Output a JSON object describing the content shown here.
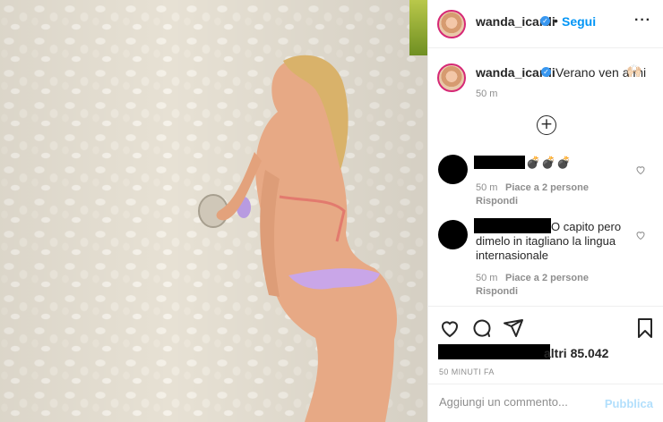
{
  "post": {
    "photo_alt": "post-photo"
  },
  "header": {
    "username": "wanda_icardi",
    "verified_glyph": "✓",
    "separator": "•",
    "follow_label": "Segui",
    "more_glyph": "···"
  },
  "caption": {
    "username": "wanda_icardi",
    "verified_glyph": "✓",
    "text": "Verano ven a mi",
    "emoji": "🙌🏻",
    "time": "50 m"
  },
  "load_more_glyph": "+",
  "comments": [
    {
      "text_visible": "💣💣💣",
      "time": "50 m",
      "likes": "Piace a 2 persone",
      "reply": "Rispondi"
    },
    {
      "text_line1": "O capito pero",
      "text_line2": "dimelo in itagliano la lingua",
      "text_line3": "internasionale",
      "time": "50 m",
      "likes": "Piace a 2 persone",
      "reply": "Rispondi"
    }
  ],
  "likes": {
    "text": "altri 85.042"
  },
  "post_time": "50 MINUTI FA",
  "composer": {
    "placeholder": "Aggiungi un commento...",
    "publish_label": "Pubblica"
  },
  "colors": {
    "link_blue": "#0095f6",
    "verified_blue": "#3897f0",
    "publish_disabled": "#b2dffc",
    "muted_text": "#8e8e8e"
  },
  "icons": [
    "heart-icon",
    "comment-icon",
    "share-icon",
    "bookmark-icon",
    "plus-circle-icon",
    "verified-icon",
    "more-icon"
  ]
}
